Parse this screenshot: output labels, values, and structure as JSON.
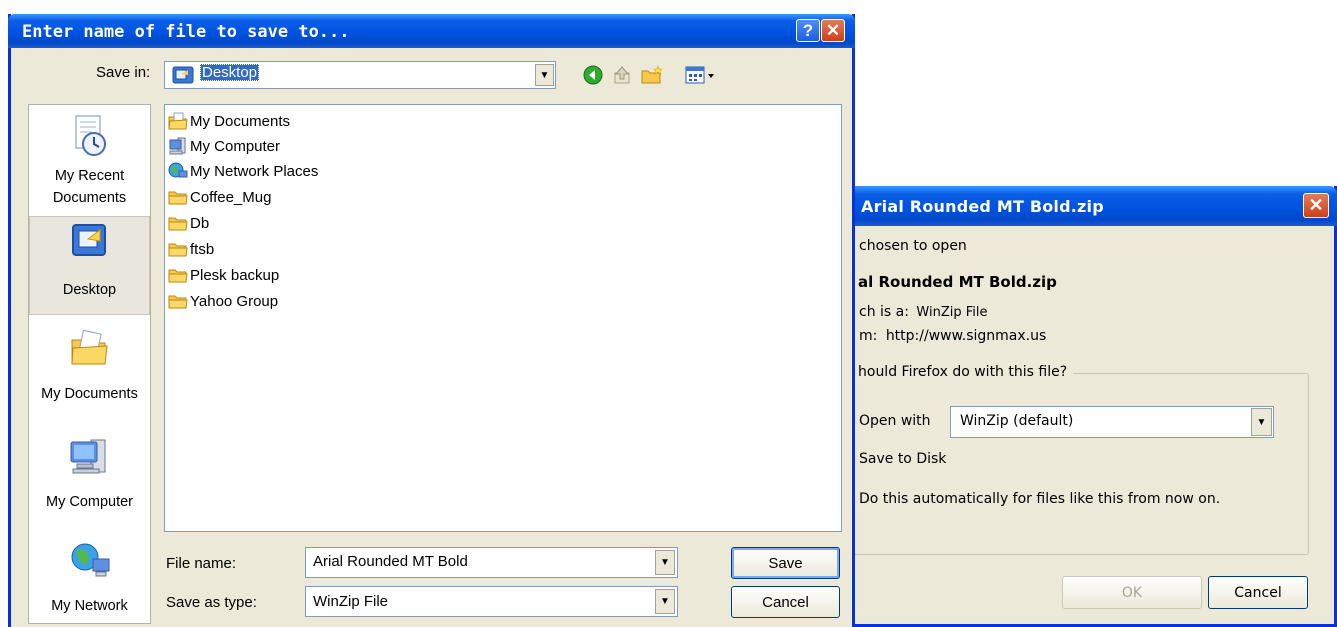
{
  "save_dialog": {
    "title": "Enter name of file to save to...",
    "help_label": "?",
    "close_label": "✕",
    "save_in_label": "Save in:",
    "save_in_value": "Desktop",
    "places": [
      {
        "label": "My Recent Documents",
        "line1": "My Recent",
        "line2": "Documents",
        "icon": "recent-documents-icon"
      },
      {
        "label": "Desktop",
        "icon": "desktop-icon"
      },
      {
        "label": "My Documents",
        "icon": "my-documents-icon"
      },
      {
        "label": "My Computer",
        "icon": "my-computer-icon"
      },
      {
        "label": "My Network",
        "icon": "my-network-icon"
      }
    ],
    "files": [
      {
        "name": "My Documents",
        "icon": "my-documents-icon"
      },
      {
        "name": "My Computer",
        "icon": "computer-icon"
      },
      {
        "name": "My Network Places",
        "icon": "network-places-icon"
      },
      {
        "name": "Coffee_Mug",
        "icon": "folder-icon"
      },
      {
        "name": "Db",
        "icon": "folder-icon"
      },
      {
        "name": "ftsb",
        "icon": "folder-icon"
      },
      {
        "name": "Plesk backup",
        "icon": "folder-icon"
      },
      {
        "name": "Yahoo Group",
        "icon": "folder-icon"
      }
    ],
    "file_name_label": "File name:",
    "file_name_value": "Arial Rounded MT Bold",
    "save_as_type_label": "Save as type:",
    "save_as_type_value": "WinZip File",
    "save_button": "Save",
    "cancel_button": "Cancel",
    "toolbar_icons": [
      "back-icon",
      "up-folder-icon",
      "new-folder-icon",
      "views-menu-icon"
    ]
  },
  "download_dialog": {
    "title": "Arial Rounded MT Bold.zip",
    "close_label": "✕",
    "chosen_text": "chosen to open",
    "file_name": "al Rounded MT Bold.zip",
    "which_is_label": "ch is a:",
    "which_is_value": "WinZip File",
    "from_label": "m:",
    "from_value": "http://www.signmax.us",
    "question": "hould Firefox do with this file?",
    "open_with_label": "Open with",
    "open_with_value": "WinZip (default)",
    "save_to_disk_label": "Save to Disk",
    "auto_label": "Do this automatically for files like this from now on.",
    "ok_button": "OK",
    "cancel_button": "Cancel"
  },
  "colors": {
    "titlebar": "#0053e1",
    "dialog_bg": "#ece9d8",
    "selection": "#316ac5",
    "close_red": "#cf3f16"
  }
}
